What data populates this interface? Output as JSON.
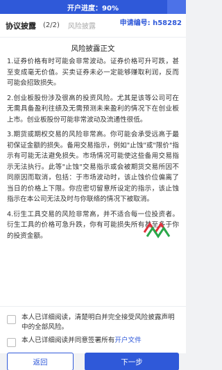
{
  "progress": {
    "label": "开户进度：90%",
    "value": 0.9
  },
  "header": {
    "active_tab": "协议披露",
    "step": "(2/2)",
    "inactive_tab": "风险披露",
    "application_no": "申请编号: h58282"
  },
  "disclosure": {
    "title": "风险披露正文",
    "paragraphs": [
      "1.证券价格有时可能会非常波动。证券价格可升可跌，甚至变成毫无价值。买卖证券未必一定能够赚取利润，反而可能会招致损失。",
      "2.创业板股份涉及很高的投资风险。尤其是该等公司可在无需具备盈利往绩及无需预测未来盈利的情况下在创业板上市。创业板股份可能非常波动及流通性很低。",
      "3.期货或期权交易的风险非常高。你可能会承受远高于最初保证金额的损失。备用交易指示，例如\"止蚀\"或\"限价\"指示有可能无法避免损失。市场情况可能使这些备用交易指示无法执行。此等\"止蚀\"交易指示或会被期货交易所因不同原因而取消，包括：于市场波动时，该止蚀价位偏离了当日的价格上下限。你应密切留意所设定的指示，该止蚀指示在本公司无法及时与你联络的情况下被取消。",
      "4.衍生工具交易的风险非常高，并不适合每一位投资者。衍生工具的价格可急升跌，你有可能损失所有甚至多于你的投资金额。"
    ]
  },
  "agreements": [
    {
      "text": "本人已详细阅读，清楚明白并完全接受风险披露声明中的全部风险。",
      "link": ""
    },
    {
      "text": "本人已详细阅读并同意签署所有",
      "link": "开户文件"
    }
  ],
  "footer": {
    "back_label": "返回",
    "next_label": "下一步"
  },
  "colors": {
    "accent": "#2f59d9",
    "watermark_red": "#e0303a",
    "watermark_green": "#29a84a"
  }
}
